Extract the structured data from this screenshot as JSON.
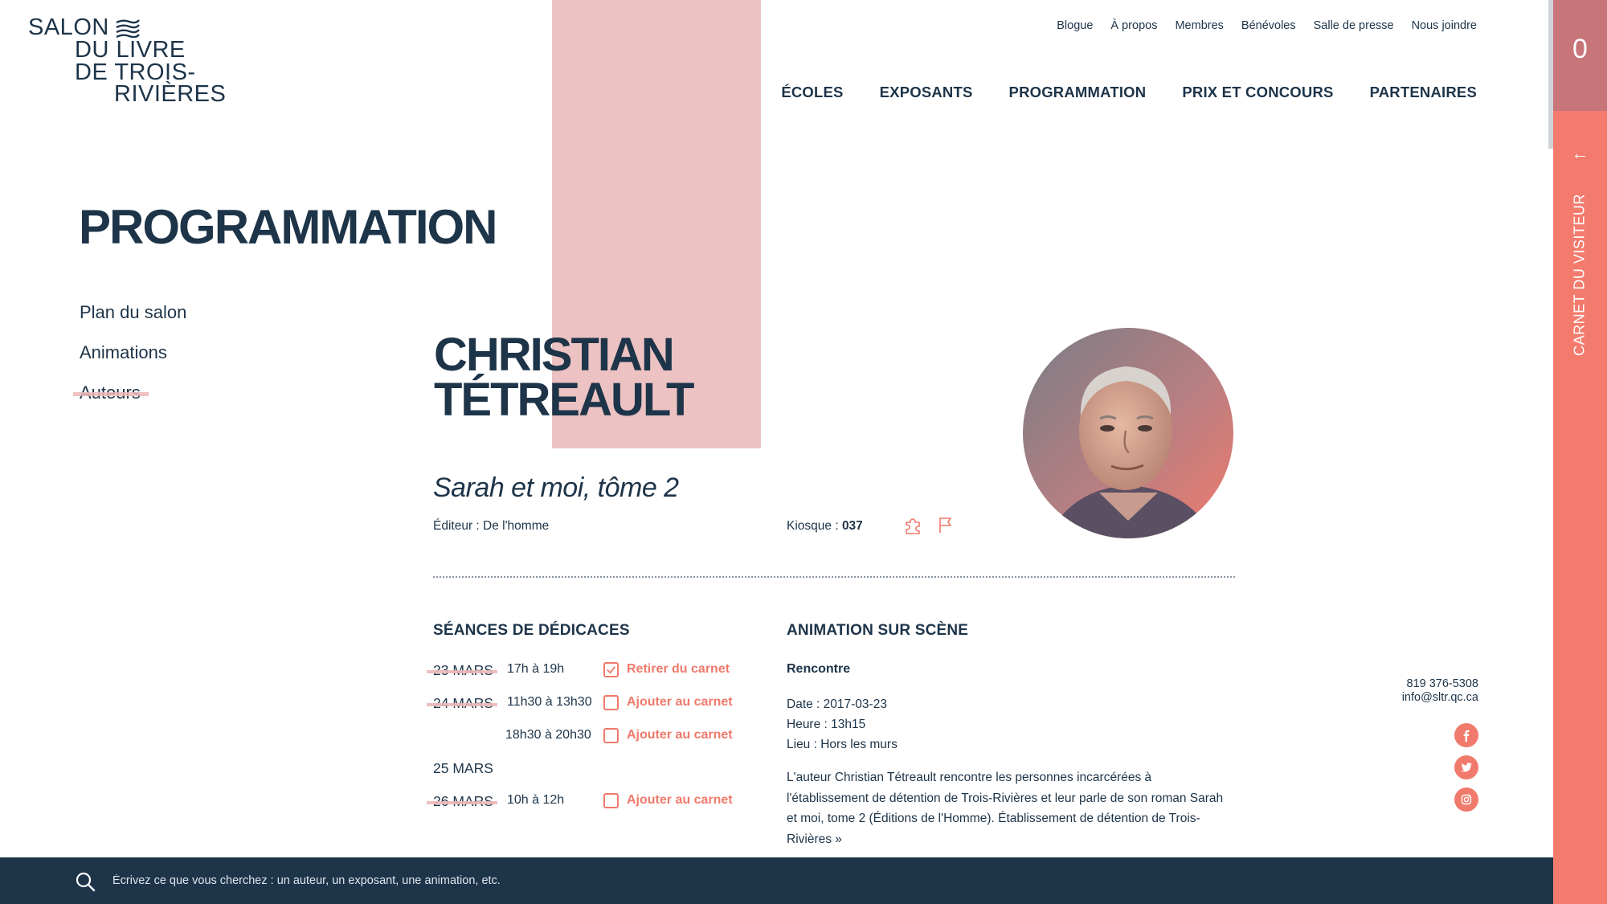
{
  "logo": {
    "line1": "SALON",
    "line2": "DU LIVRE",
    "line3": "DE TROIS-",
    "line4": "RIVIÈRES"
  },
  "utility_nav": [
    "Blogue",
    "À propos",
    "Membres",
    "Bénévoles",
    "Salle de presse",
    "Nous joindre"
  ],
  "main_nav": [
    "ÉCOLES",
    "EXPOSANTS",
    "PROGRAMMATION",
    "PRIX ET CONCOURS",
    "PARTENAIRES"
  ],
  "page_title": "PROGRAMMATION",
  "subnav": [
    {
      "label": "Plan du salon",
      "active": false
    },
    {
      "label": "Animations",
      "active": false
    },
    {
      "label": "Auteurs",
      "active": true
    }
  ],
  "author": {
    "first_name": "CHRISTIAN",
    "last_name": "TÉTREAULT",
    "book_title": "Sarah et moi, tôme 2",
    "publisher_label": "Éditeur : ",
    "publisher": "De l'homme",
    "kiosque_label": "Kiosque : ",
    "kiosque": "037"
  },
  "signatures": {
    "title": "SÉANCES DE DÉDICACES",
    "rows": [
      {
        "date": "23 MARS",
        "time": "17h à 19h",
        "action": "Retirer du carnet",
        "checked": true
      },
      {
        "date": "24 MARS",
        "time": "11h30 à 13h30",
        "action": "Ajouter au carnet",
        "checked": false
      },
      {
        "date": "",
        "time": "18h30 à 20h30",
        "action": "Ajouter au carnet",
        "checked": false
      },
      {
        "date": "25 MARS",
        "time": "",
        "action": "",
        "checked": false
      },
      {
        "date": "26 MARS",
        "time": "10h à 12h",
        "action": "Ajouter au carnet",
        "checked": false
      }
    ]
  },
  "animation": {
    "title": "ANIMATION SUR SCÈNE",
    "type": "Rencontre",
    "date": "Date : 2017-03-23",
    "heure": "Heure : 13h15",
    "lieu": "Lieu : Hors les murs",
    "description": "L'auteur Christian Tétreault rencontre les personnes incarcérées à l'établissement de détention de Trois-Rivières et leur parle de son roman Sarah et moi, tome 2 (Éditions de l'Homme). Établissement de détention de Trois-Rivières »"
  },
  "contact": {
    "phone": "819 376-5308",
    "email": "info@sltr.qc.ca"
  },
  "social": [
    "facebook-icon",
    "twitter-icon",
    "instagram-icon"
  ],
  "search": {
    "placeholder": "Écrivez ce que vous cherchez : un auteur, un exposant, une animation, etc."
  },
  "side_panel": {
    "count": "0",
    "arrow": "←",
    "label": "CARNET DU VISITEUR"
  },
  "colors": {
    "navy": "#1d3449",
    "coral": "#f37b6e",
    "pink": "#ecc2c2",
    "mauve": "#c77579"
  }
}
